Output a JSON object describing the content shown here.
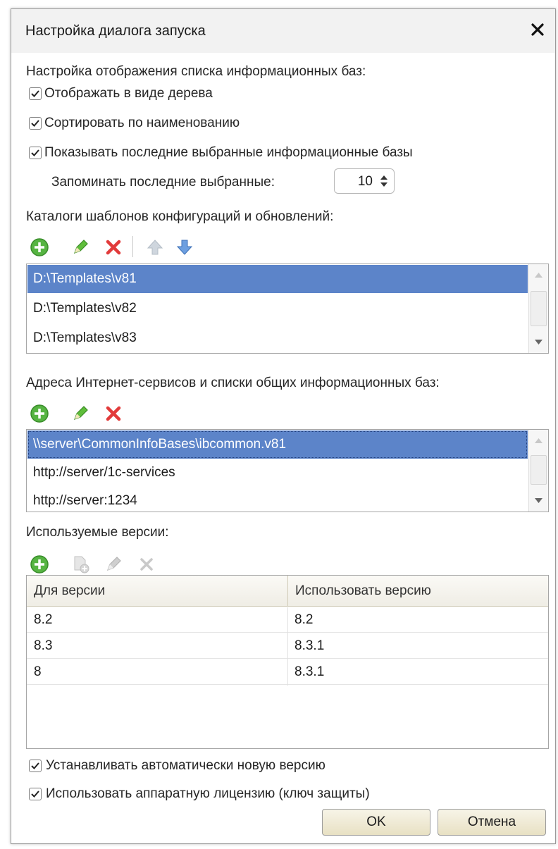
{
  "window": {
    "title": "Настройка диалога запуска"
  },
  "display_section": {
    "heading": "Настройка отображения списка информационных баз:",
    "show_as_tree": {
      "label": "Отображать в виде дерева",
      "checked": true
    },
    "sort_by_name": {
      "label": "Сортировать по наименованию",
      "checked": true
    },
    "show_recent": {
      "label": "Показывать последние выбранные информационные базы",
      "checked": true
    },
    "remember_recent": {
      "label": "Запоминать последние выбранные:",
      "value": "10"
    }
  },
  "templates_section": {
    "heading": "Каталоги шаблонов конфигураций и обновлений:",
    "items": [
      "D:\\Templates\\v81",
      "D:\\Templates\\v82",
      "D:\\Templates\\v83"
    ],
    "selected_index": 0
  },
  "services_section": {
    "heading": "Адреса Интернет-сервисов и списки общих информационных баз:",
    "items": [
      "\\\\server\\CommonInfoBases\\ibcommon.v81",
      "http://server/1c-services",
      "http://server:1234"
    ],
    "selected_index": 0
  },
  "versions_section": {
    "heading": "Используемые версии:",
    "columns": [
      "Для версии",
      "Использовать версию"
    ],
    "rows": [
      [
        "8.2",
        "8.2"
      ],
      [
        "8.3",
        "8.3.1"
      ],
      [
        "8",
        "8.3.1"
      ]
    ]
  },
  "options": {
    "auto_install": {
      "label": "Устанавливать автоматически новую версию",
      "checked": true
    },
    "hardware_license": {
      "label": "Использовать аппаратную лицензию (ключ защиты)",
      "checked": true
    }
  },
  "buttons": {
    "ok": "OK",
    "cancel": "Отмена"
  },
  "colors": {
    "selection": "#5c84c9",
    "add_icon": "#4caf3a",
    "edit_icon": "#58b33a",
    "delete_icon": "#e23b3b",
    "arrow_icon": "#5b8fd6"
  }
}
